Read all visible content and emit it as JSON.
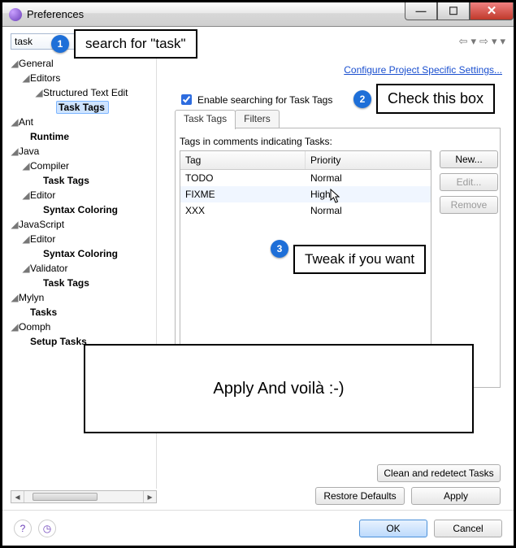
{
  "window": {
    "title": "Preferences"
  },
  "search": {
    "value": "task"
  },
  "tree": {
    "items": [
      {
        "depth": 0,
        "label": "General",
        "expanded": true
      },
      {
        "depth": 1,
        "label": "Editors",
        "expanded": true
      },
      {
        "depth": 2,
        "label": "Structured Text Edit",
        "expanded": true
      },
      {
        "depth": 3,
        "label": "Task Tags",
        "bold": true,
        "selected": true
      },
      {
        "depth": 0,
        "label": "Ant",
        "expanded": true
      },
      {
        "depth": 1,
        "label": "Runtime",
        "bold": true
      },
      {
        "depth": 0,
        "label": "Java",
        "expanded": true
      },
      {
        "depth": 1,
        "label": "Compiler",
        "expanded": true
      },
      {
        "depth": 2,
        "label": "Task Tags",
        "bold": true
      },
      {
        "depth": 1,
        "label": "Editor",
        "expanded": true
      },
      {
        "depth": 2,
        "label": "Syntax Coloring",
        "bold": true
      },
      {
        "depth": 0,
        "label": "JavaScript",
        "expanded": true
      },
      {
        "depth": 1,
        "label": "Editor",
        "expanded": true
      },
      {
        "depth": 2,
        "label": "Syntax Coloring",
        "bold": true
      },
      {
        "depth": 1,
        "label": "Validator",
        "expanded": true
      },
      {
        "depth": 2,
        "label": "Task Tags",
        "bold": true
      },
      {
        "depth": 0,
        "label": "Mylyn",
        "expanded": true
      },
      {
        "depth": 1,
        "label": "Tasks",
        "bold": true
      },
      {
        "depth": 0,
        "label": "Oomph",
        "expanded": true
      },
      {
        "depth": 1,
        "label": "Setup Tasks",
        "bold": true
      }
    ]
  },
  "link": {
    "configure": "Configure Project Specific Settings..."
  },
  "checkbox": {
    "enable": "Enable searching for Task Tags"
  },
  "tabs": {
    "tasktags": "Task Tags",
    "filters": "Filters"
  },
  "table": {
    "title": "Tags in comments indicating Tasks:",
    "columns": [
      "Tag",
      "Priority"
    ],
    "rows": [
      {
        "tag": "TODO",
        "priority": "Normal"
      },
      {
        "tag": "FIXME",
        "priority": "High"
      },
      {
        "tag": "XXX",
        "priority": "Normal"
      }
    ]
  },
  "sidebuttons": {
    "new": "New...",
    "edit": "Edit...",
    "remove": "Remove"
  },
  "bottom": {
    "clean": "Clean and redetect Tasks",
    "restore": "Restore Defaults",
    "apply": "Apply"
  },
  "footer": {
    "ok": "OK",
    "cancel": "Cancel"
  },
  "annotations": {
    "b1": "1",
    "n1": "search  for \"task\"",
    "b2": "2",
    "n2": "Check this box",
    "b3": "3",
    "n3": "Tweak if you want",
    "n4": "Apply And voilà :-)"
  }
}
